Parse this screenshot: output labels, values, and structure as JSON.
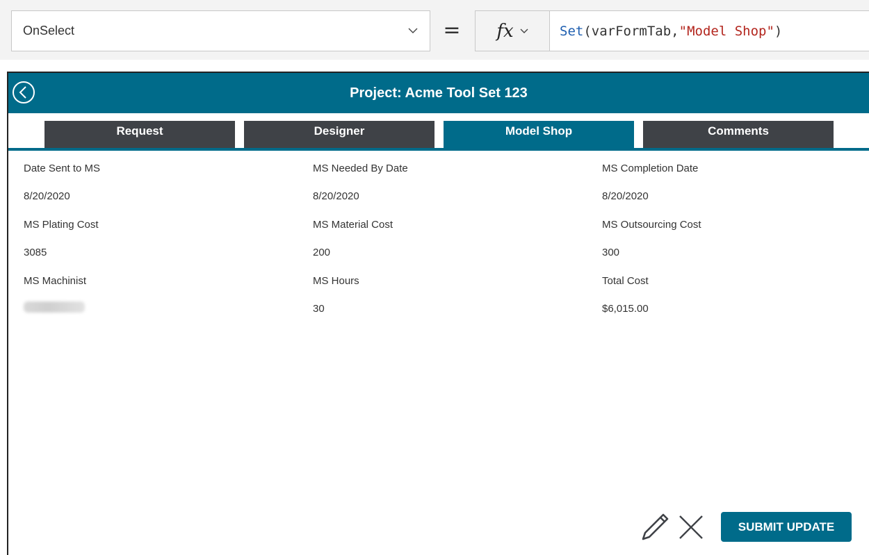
{
  "formula_bar": {
    "property": "OnSelect",
    "equals": "=",
    "fx_label": "fx",
    "formula": {
      "function": "Set",
      "open": "(",
      "args": "varFormTab, ",
      "string": "\"Model Shop\"",
      "close": ")"
    }
  },
  "header": {
    "title": "Project:  Acme Tool Set 123"
  },
  "tabs": [
    {
      "label": "Request",
      "active": false
    },
    {
      "label": "Designer",
      "active": false
    },
    {
      "label": "Model Shop",
      "active": true
    },
    {
      "label": "Comments",
      "active": false
    }
  ],
  "fields": [
    {
      "label": "Date Sent to MS",
      "value": "8/20/2020"
    },
    {
      "label": "MS Needed By Date",
      "value": "8/20/2020"
    },
    {
      "label": "MS Completion Date",
      "value": "8/20/2020"
    },
    {
      "label": "MS Plating Cost",
      "value": "3085"
    },
    {
      "label": "MS Material Cost",
      "value": "200"
    },
    {
      "label": "MS Outsourcing Cost",
      "value": "300"
    },
    {
      "label": "MS Machinist",
      "value": ""
    },
    {
      "label": "MS Hours",
      "value": "30"
    },
    {
      "label": "Total Cost",
      "value": "$6,015.00"
    }
  ],
  "actions": {
    "edit_icon": "pencil-icon",
    "cancel_icon": "close-icon",
    "submit_label": "SUBMIT UPDATE"
  },
  "colors": {
    "accent": "#006b8a",
    "tab_inactive": "#3f4247",
    "formula_function": "#1f5fb0",
    "formula_string": "#b3261e"
  }
}
